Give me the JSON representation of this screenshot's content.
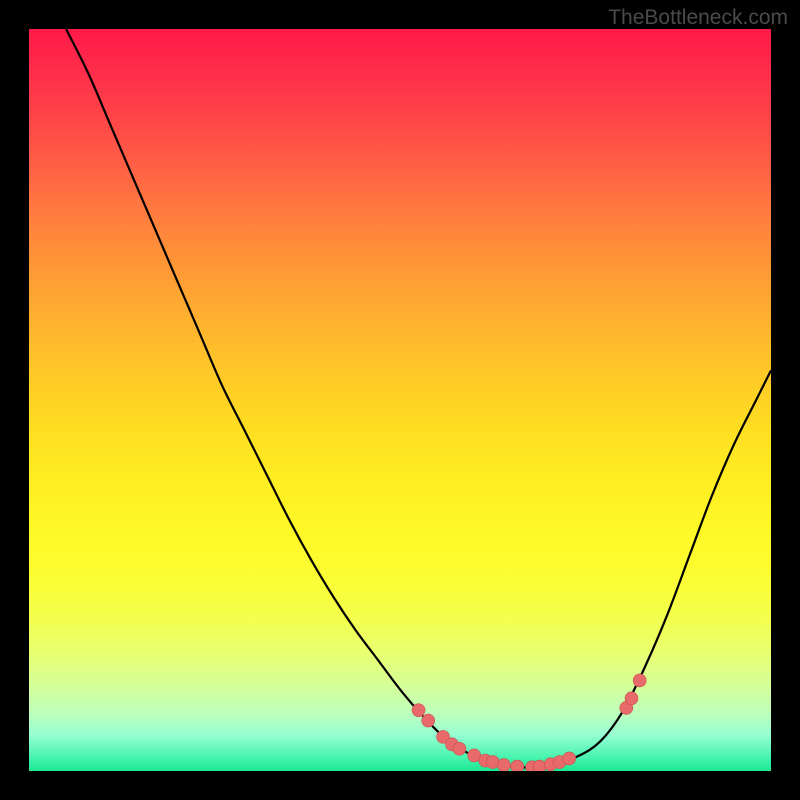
{
  "watermark": "TheBottleneck.com",
  "chart_data": {
    "type": "line",
    "title": "",
    "xlabel": "",
    "ylabel": "",
    "xlim": [
      0,
      100
    ],
    "ylim": [
      0,
      100
    ],
    "colors": {
      "curve": "#000000",
      "dot_fill": "#e86a6a",
      "dot_stroke": "#c94f4f",
      "gradient_top": "#ff1a48",
      "gradient_mid": "#ffde22",
      "gradient_bottom": "#1be893"
    },
    "curve_points": [
      {
        "x": 5.0,
        "y": 100.0
      },
      {
        "x": 8.0,
        "y": 94.0
      },
      {
        "x": 11.0,
        "y": 87.0
      },
      {
        "x": 14.0,
        "y": 80.0
      },
      {
        "x": 17.0,
        "y": 73.0
      },
      {
        "x": 20.0,
        "y": 66.0
      },
      {
        "x": 23.0,
        "y": 59.0
      },
      {
        "x": 26.0,
        "y": 52.0
      },
      {
        "x": 29.0,
        "y": 46.0
      },
      {
        "x": 32.0,
        "y": 40.0
      },
      {
        "x": 35.0,
        "y": 34.0
      },
      {
        "x": 38.0,
        "y": 28.5
      },
      {
        "x": 41.0,
        "y": 23.5
      },
      {
        "x": 44.0,
        "y": 19.0
      },
      {
        "x": 47.0,
        "y": 15.0
      },
      {
        "x": 50.0,
        "y": 11.0
      },
      {
        "x": 53.0,
        "y": 7.5
      },
      {
        "x": 56.0,
        "y": 4.5
      },
      {
        "x": 59.0,
        "y": 2.5
      },
      {
        "x": 62.0,
        "y": 1.2
      },
      {
        "x": 65.0,
        "y": 0.6
      },
      {
        "x": 68.0,
        "y": 0.5
      },
      {
        "x": 71.0,
        "y": 1.0
      },
      {
        "x": 74.0,
        "y": 2.0
      },
      {
        "x": 77.0,
        "y": 4.0
      },
      {
        "x": 80.0,
        "y": 8.0
      },
      {
        "x": 83.0,
        "y": 14.0
      },
      {
        "x": 86.0,
        "y": 21.0
      },
      {
        "x": 89.0,
        "y": 29.0
      },
      {
        "x": 92.0,
        "y": 37.0
      },
      {
        "x": 95.0,
        "y": 44.0
      },
      {
        "x": 98.0,
        "y": 50.0
      },
      {
        "x": 100.0,
        "y": 54.0
      }
    ],
    "dots": [
      {
        "x": 52.5,
        "y": 8.2
      },
      {
        "x": 53.8,
        "y": 6.8
      },
      {
        "x": 55.8,
        "y": 4.6
      },
      {
        "x": 57.0,
        "y": 3.6
      },
      {
        "x": 58.0,
        "y": 3.0
      },
      {
        "x": 60.0,
        "y": 2.1
      },
      {
        "x": 61.5,
        "y": 1.4
      },
      {
        "x": 62.5,
        "y": 1.2
      },
      {
        "x": 64.0,
        "y": 0.8
      },
      {
        "x": 65.8,
        "y": 0.6
      },
      {
        "x": 67.8,
        "y": 0.5
      },
      {
        "x": 68.8,
        "y": 0.6
      },
      {
        "x": 70.3,
        "y": 0.9
      },
      {
        "x": 71.5,
        "y": 1.2
      },
      {
        "x": 72.8,
        "y": 1.7
      },
      {
        "x": 80.5,
        "y": 8.5
      },
      {
        "x": 81.2,
        "y": 9.8
      },
      {
        "x": 82.3,
        "y": 12.2
      }
    ]
  }
}
